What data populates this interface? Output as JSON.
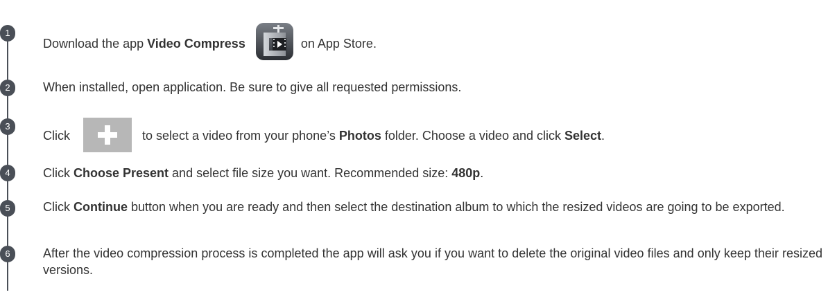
{
  "steps": [
    {
      "number": "1",
      "t1": "Download the app ",
      "b1": "Video Compress",
      "icon": "video-compress-app-icon",
      "t2": " on App Store."
    },
    {
      "number": "2",
      "t1": "When installed, open application. Be sure to give all requested permissions."
    },
    {
      "number": "3",
      "t1": "Click ",
      "icon": "plus-icon",
      "t2": " to select a video from your phone’s ",
      "b1": "Photos",
      "t3": " folder. Choose a video and click ",
      "b2": "Select",
      "t4": "."
    },
    {
      "number": "4",
      "t1": "Click ",
      "b1": "Choose Present",
      "t2": " and select file size you want. Recommended size: ",
      "b2": "480p",
      "t3": "."
    },
    {
      "number": "5",
      "t1": "Click ",
      "b1": "Continue",
      "t2": " button when you are ready and then select the destination album to which the resized videos are going to be exported."
    },
    {
      "number": "6",
      "t1": "After the video compression process is completed the app will ask you if you want to delete the original video files and only keep their resized versions."
    }
  ],
  "colors": {
    "badge": "#4a4f57",
    "text": "#333333",
    "plus_tile": "#b7b7b7"
  }
}
